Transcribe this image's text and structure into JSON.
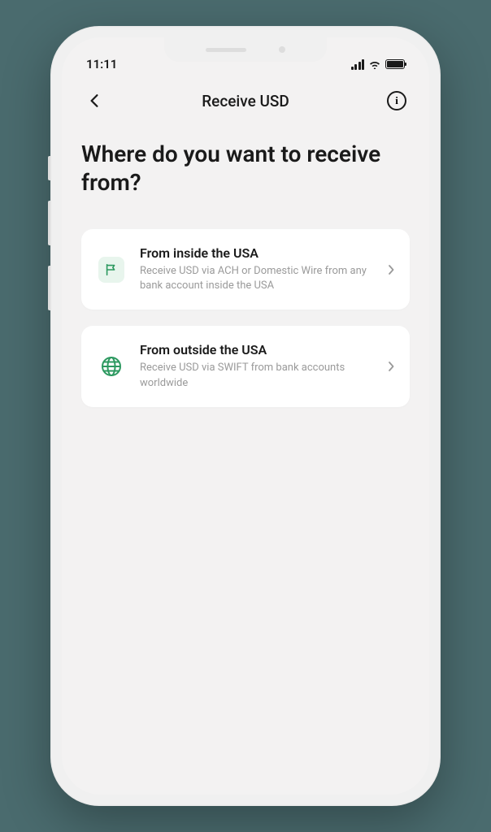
{
  "status": {
    "time": "11:11"
  },
  "nav": {
    "title": "Receive USD"
  },
  "heading": "Where do you want to receive from?",
  "options": [
    {
      "title": "From inside the USA",
      "description": "Receive USD via ACH or Domestic Wire from any bank account inside the USA"
    },
    {
      "title": "From outside the USA",
      "description": "Receive USD via SWIFT from bank accounts worldwide"
    }
  ]
}
